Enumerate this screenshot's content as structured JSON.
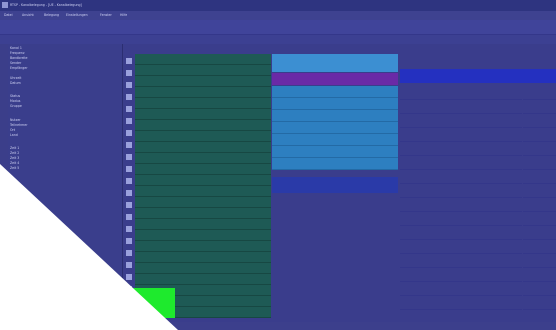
{
  "window": {
    "title": "RTSP - Kanalbelegung - [UE - Kanalbelegung]"
  },
  "menus": [
    "Datei",
    "Ansicht",
    "Belegung",
    "Einstellungen",
    "Fenster",
    "Hilfe"
  ],
  "toolbar": [
    "Drucken",
    "Zoom",
    "Suchen",
    "Export",
    "Aktualisieren",
    "Einstellungen",
    "Kanal",
    "Bearbeiten",
    "Filter"
  ],
  "left_panel": {
    "rows": [
      "Kanal 1",
      "Frequenz",
      "Bandbreite",
      "Sender",
      "Empfänger",
      "",
      "Uhrzeit",
      "Datum",
      "",
      "Status",
      "Modus",
      "Gruppe",
      "",
      "Nutzer",
      "Teilnehmer",
      "Ort",
      "Land",
      "",
      "Zeit 1",
      "Zeit 2",
      "Zeit 3",
      "Zeit 4",
      "Zeit 5",
      "",
      "Zeile 1",
      "Zeile 2",
      "Zeile 3",
      "Zeile 4",
      "Zeile 5"
    ]
  },
  "grid": {
    "rows": 23
  }
}
